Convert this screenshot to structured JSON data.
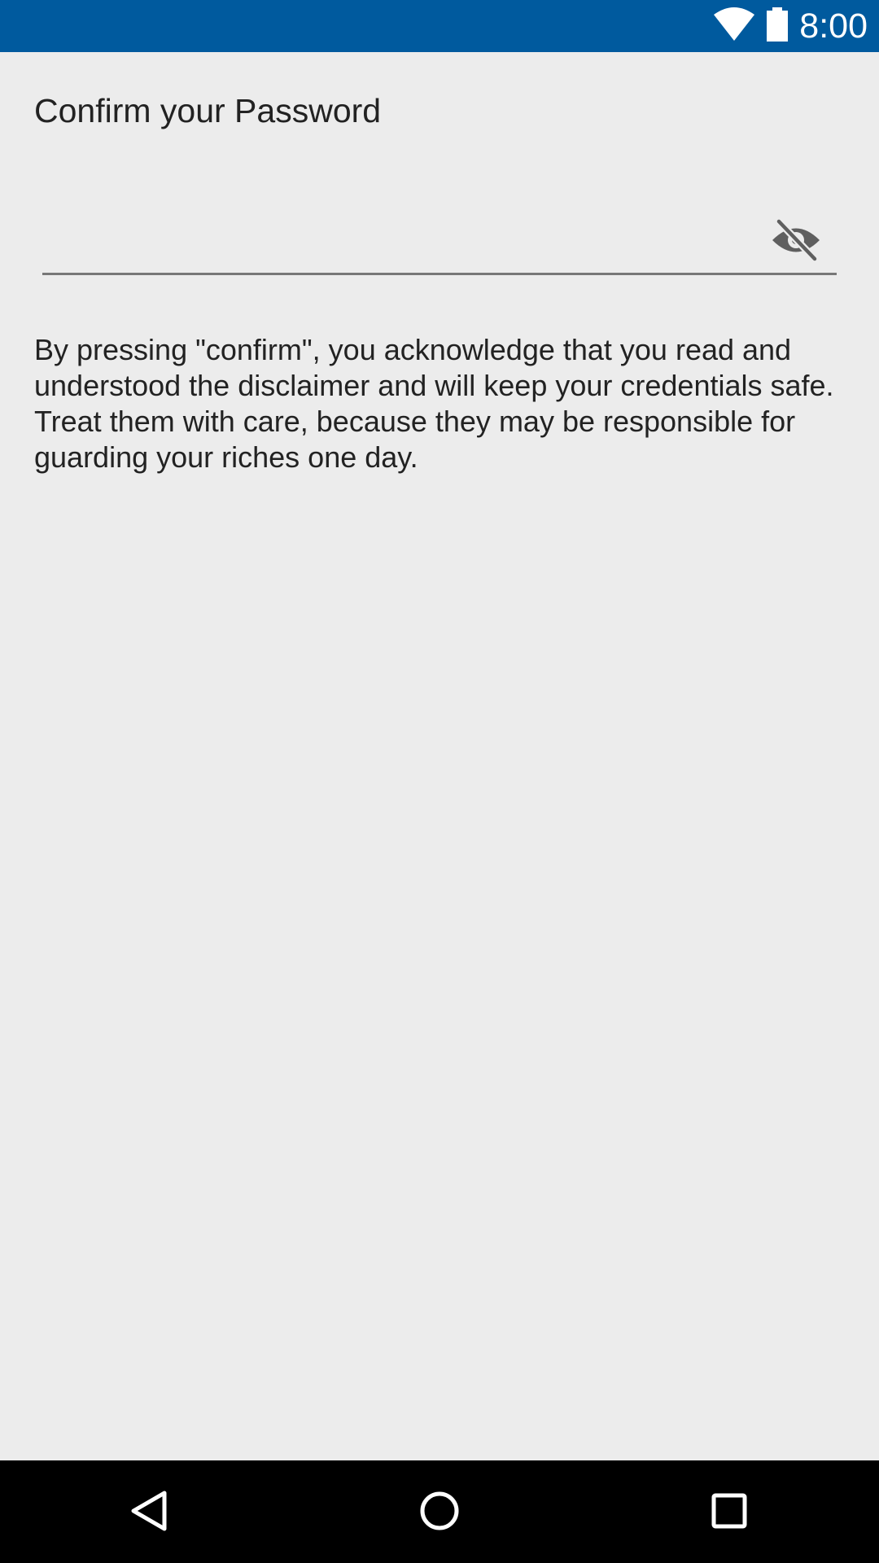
{
  "status_bar": {
    "time": "8:00",
    "background": "#005a9e",
    "icons": [
      "wifi-icon",
      "battery-icon"
    ]
  },
  "screen": {
    "title": "Confirm your Password",
    "password_field": {
      "value": "",
      "placeholder": "",
      "toggle_icon": "visibility-off-icon"
    },
    "disclaimer": "By pressing \"confirm\", you acknowledge that you read and understood the disclaimer and will keep your credentials safe. Treat them with care, because they may be responsible for guarding your riches one day."
  },
  "nav_bar": {
    "buttons": [
      "back-icon",
      "home-icon",
      "recents-icon"
    ]
  },
  "colors": {
    "background": "#ececec",
    "text": "#222222",
    "underline": "#777777",
    "icon": "#5f5f5f"
  }
}
